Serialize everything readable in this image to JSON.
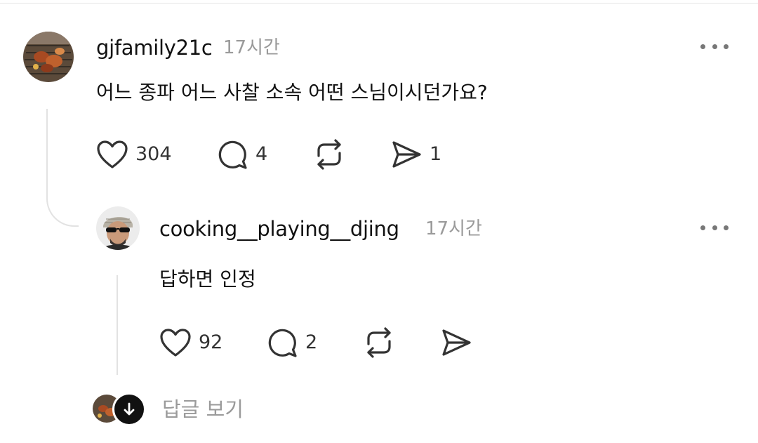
{
  "comment": {
    "username": "gjfamily21c",
    "time": "17시간",
    "text": "어느 종파 어느 사찰 소속 어떤 스님이시던가요?",
    "likes": "304",
    "replies": "4",
    "shares": "1",
    "icons": [
      "heart-icon",
      "comment-icon",
      "repost-icon",
      "send-icon",
      "more-icon"
    ]
  },
  "reply": {
    "username": "cooking__playing__djing",
    "time": "17시간",
    "text": "답하면 인정",
    "likes": "92",
    "replies": "2"
  },
  "view_replies": {
    "label": "답글 보기"
  },
  "colors": {
    "text": "#111111",
    "muted": "#9a9a9a",
    "divider": "#e2e2e2",
    "icon": "#333333"
  }
}
